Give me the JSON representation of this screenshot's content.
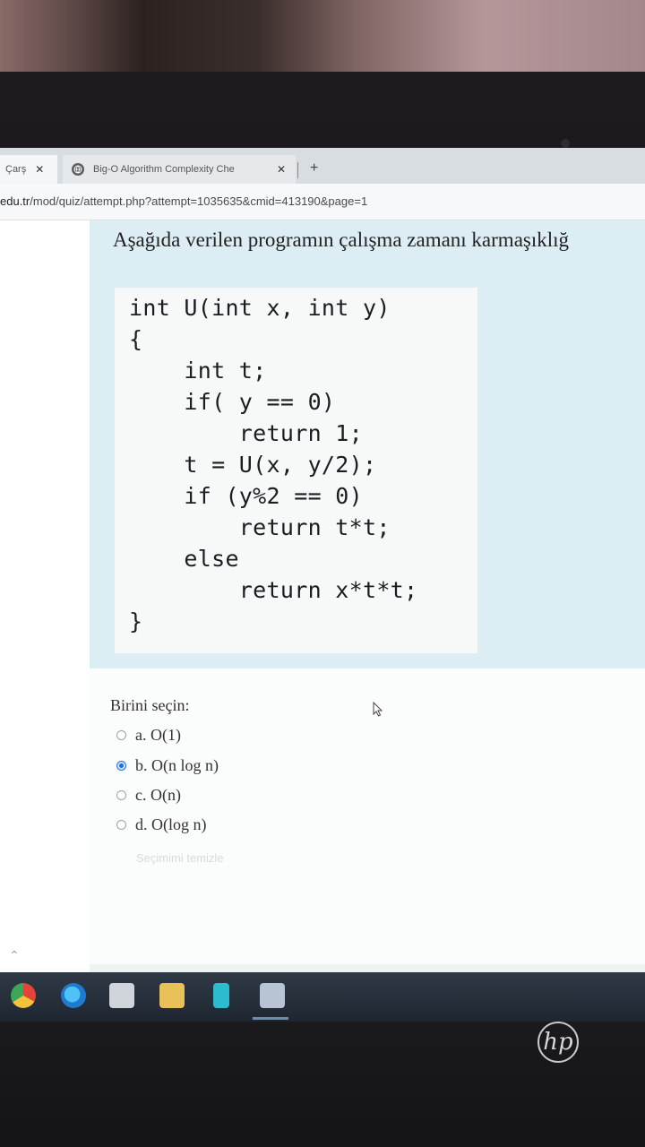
{
  "browser": {
    "tabs": [
      {
        "label": "Çarş"
      },
      {
        "label": "Big-O Algorithm Complexity Che"
      }
    ],
    "new_tab_label": "+",
    "close_label": "✕",
    "url_host": "edu.tr",
    "url_path": "/mod/quiz/attempt.php?attempt=1035635&cmid=413190&page=1"
  },
  "question": {
    "text": "Aşağıda verilen programın çalışma zamanı karmaşıklığ",
    "code_lines": [
      "int U(int x, int y)",
      "{",
      "    int t;",
      "    if( y == 0)",
      "        return 1;",
      "    t = U(x, y/2);",
      "    if (y%2 == 0)",
      "        return t*t;",
      "    else",
      "        return x*t*t;",
      "}"
    ]
  },
  "answer": {
    "prompt": "Birini seçin:",
    "options": [
      {
        "label": "a. O(1)",
        "selected": false
      },
      {
        "label": "b. O(n log n)",
        "selected": true
      },
      {
        "label": "c. O(n)",
        "selected": false
      },
      {
        "label": "d. O(log n)",
        "selected": false
      }
    ],
    "clear_label": "Seçimimi temizle"
  },
  "taskbar": {
    "icons": [
      "chrome-icon",
      "edge-icon",
      "store-icon",
      "file-explorer-icon",
      "app-icon",
      "media-icon"
    ]
  },
  "laptop": {
    "brand": "hp"
  }
}
